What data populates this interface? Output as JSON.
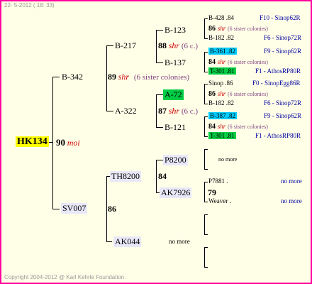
{
  "header": {
    "date": "22-  5-2012 ( 18: 33)"
  },
  "footer": {
    "copyright": "Copyright 2004-2012 @ Karl Kehrle Foundation."
  },
  "root": {
    "id": "HK134",
    "year": "90",
    "origin": "moi"
  },
  "gen1": {
    "father": {
      "id": "B-342",
      "year": "89",
      "origin": "shr",
      "colonies": "(6 sister colonies)"
    },
    "mother": {
      "id": "SV007",
      "year": "86"
    }
  },
  "gen2": {
    "ff": {
      "id": "B-217",
      "year": "88",
      "origin": "shr",
      "colonies": "(6 c.)"
    },
    "fm": {
      "id": "A-322",
      "year": "87",
      "origin": "shr",
      "colonies": "(6 c.)"
    },
    "mf": {
      "id": "TH8200",
      "year": "84"
    },
    "mm": {
      "id": "AK044",
      "nomore": "no more"
    }
  },
  "gen3": {
    "fff": {
      "id": "B-123"
    },
    "ffm": {
      "id": "B-137"
    },
    "fmf": {
      "id": "A-72"
    },
    "fmm": {
      "id": "B-121"
    },
    "mff": {
      "id": "P8200",
      "nomore": "no more"
    },
    "mfm": {
      "id": "AK7926",
      "year": "79"
    }
  },
  "gen4": [
    {
      "id": "B-428",
      "year": ".84",
      "origin": "",
      "colonies": "",
      "pedigree": "F10 - Sinop62R"
    },
    {
      "id": "",
      "year": "86",
      "origin": "shr",
      "colonies": "(6 sister colonies)",
      "pedigree": ""
    },
    {
      "id": "B-182",
      "year": ".82",
      "origin": "",
      "colonies": "",
      "pedigree": "F6 - Sinop72R"
    },
    {
      "id": "B-361",
      "year": ".82",
      "origin": "",
      "colonies": "",
      "pedigree": "F9 - Sinop62R"
    },
    {
      "id": "",
      "year": "84",
      "origin": "shr",
      "colonies": "(6 sister colonies)",
      "pedigree": ""
    },
    {
      "id": "T-301",
      "year": ".81",
      "origin": "",
      "colonies": "",
      "pedigree": "F1 - AthosRP80R"
    },
    {
      "id": "Sinop",
      "year": ".86",
      "origin": "",
      "colonies": "",
      "pedigree": "F0 - SinopEgg86R"
    },
    {
      "id": "",
      "year": "86",
      "origin": "shr",
      "colonies": "(6 sister colonies)",
      "pedigree": ""
    },
    {
      "id": "B-182",
      "year": ".82",
      "origin": "",
      "colonies": "",
      "pedigree": "F6 - Sinop72R"
    },
    {
      "id": "B-387",
      "year": ".82",
      "origin": "",
      "colonies": "",
      "pedigree": "F9 - Sinop62R"
    },
    {
      "id": "",
      "year": "84",
      "origin": "shr",
      "colonies": "(6 sister colonies)",
      "pedigree": ""
    },
    {
      "id": "T-301",
      "year": ".81",
      "origin": "",
      "colonies": "",
      "pedigree": "F1 - AthosRP80R"
    }
  ],
  "gen4_mother_side": {
    "p8200_nomore": "no more",
    "p7881": {
      "id": "P7881",
      "year": ".",
      "nomore": "no more"
    },
    "weaver": {
      "id": "Weaver",
      "year": ".",
      "nomore": "no more"
    }
  },
  "colors": {
    "border": "#ff00a0",
    "background": "#ffffe8",
    "highlight_root": "#ffff00",
    "highlight_green": "#00cc44",
    "highlight_cyan": "#00ccff",
    "text_blue": "#0000a0",
    "text_red": "#cc0000",
    "text_purple": "#7f3f7f"
  }
}
